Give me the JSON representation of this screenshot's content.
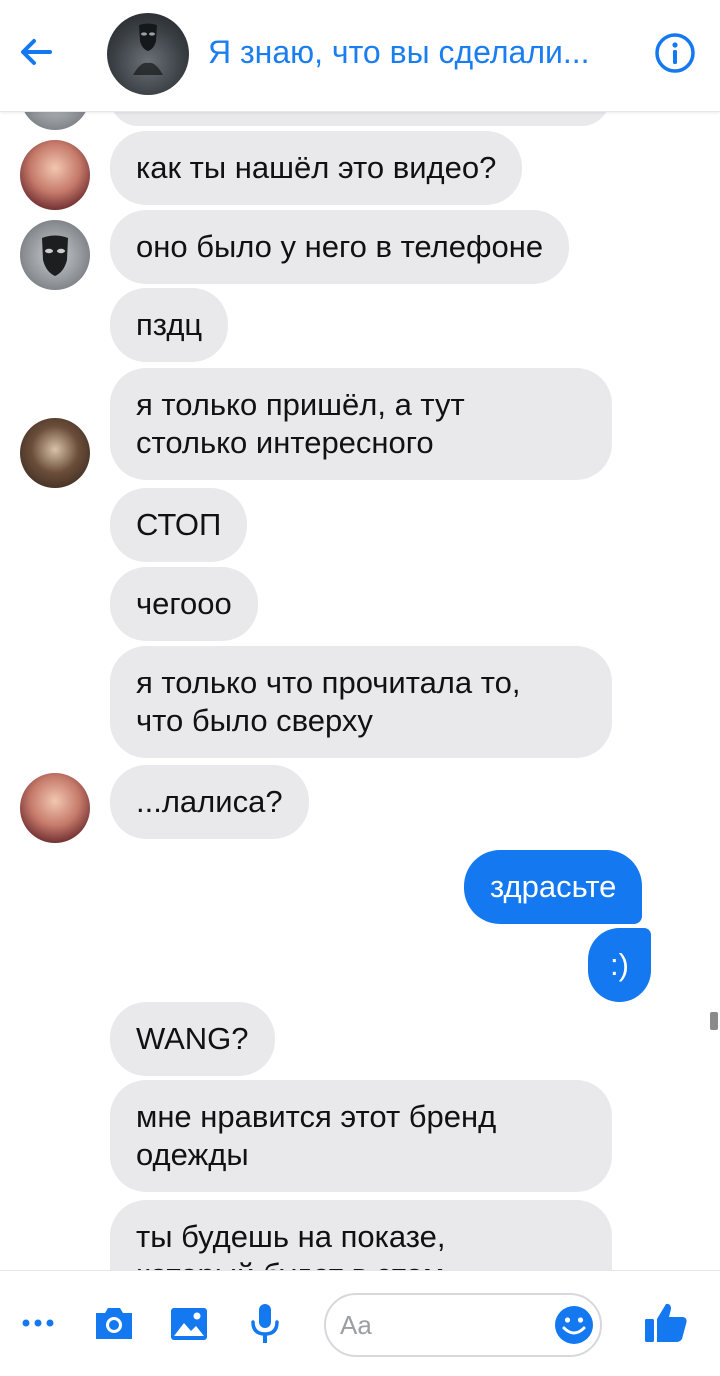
{
  "header": {
    "title": "Я знаю, что вы сделали...",
    "back_icon": "arrow-left-icon",
    "info_icon": "info-icon"
  },
  "messages": [
    {
      "sender": "girl",
      "text": "как ты нашёл это видео?",
      "direction": "in"
    },
    {
      "sender": "mask",
      "text": "оно было у него в телефоне",
      "direction": "in"
    },
    {
      "sender": "boy",
      "text": "пздц",
      "direction": "in"
    },
    {
      "sender": "boy",
      "lines": [
        "я только пришёл, а тут",
        "столько интересного"
      ],
      "direction": "in"
    },
    {
      "sender": "girl",
      "text": "СТОП",
      "direction": "in"
    },
    {
      "sender": "girl",
      "text": "чегооо",
      "direction": "in"
    },
    {
      "sender": "girl",
      "lines": [
        "я только что прочитала то,",
        "что было сверху"
      ],
      "direction": "in"
    },
    {
      "sender": "girl",
      "text": "...лалиса?",
      "direction": "in"
    },
    {
      "sender": "me",
      "text": "здрасьте",
      "direction": "out"
    },
    {
      "sender": "me",
      "text": ":)",
      "direction": "out"
    },
    {
      "sender": "unknown",
      "text": "WANG?",
      "direction": "in"
    },
    {
      "sender": "unknown",
      "lines": [
        "мне нравится этот бренд",
        "одежды"
      ],
      "direction": "in"
    },
    {
      "sender": "unknown",
      "lines": [
        "ты будешь на показе,",
        "который будет в этом"
      ],
      "direction": "in"
    }
  ],
  "composer": {
    "placeholder": "Aa",
    "icons": [
      "more-icon",
      "camera-icon",
      "image-icon",
      "microphone-icon",
      "emoji-icon",
      "like-icon"
    ]
  },
  "colors": {
    "accent": "#1478f0",
    "incoming_bubble": "#e9e9ec",
    "outgoing_text": "#ffffff"
  }
}
